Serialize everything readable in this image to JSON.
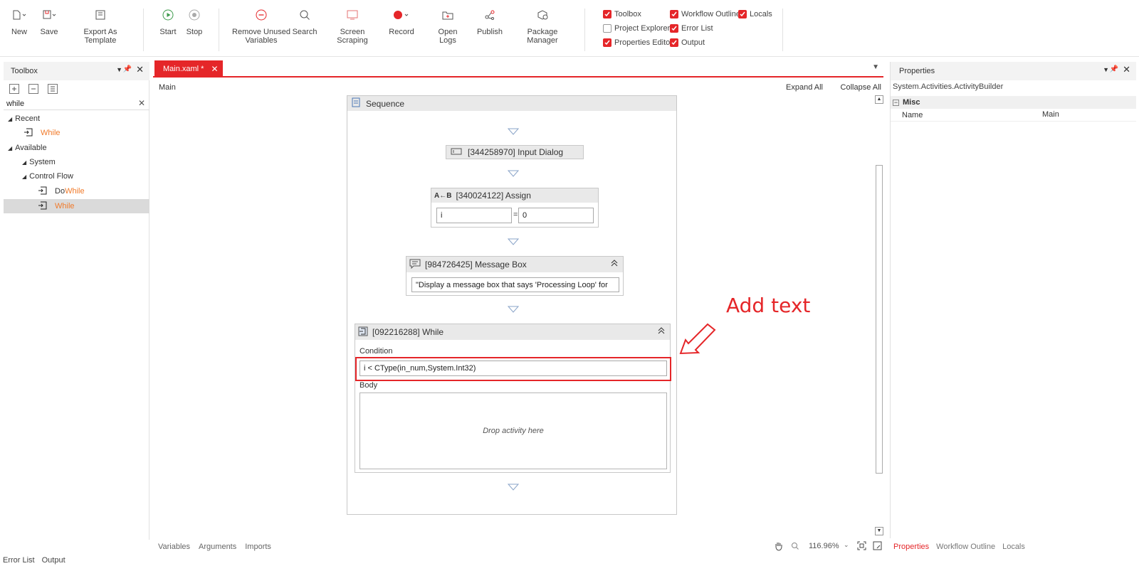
{
  "ribbon": {
    "new": "New",
    "save": "Save",
    "export_template": "Export As Template",
    "start": "Start",
    "stop": "Stop",
    "remove_unused": "Remove Unused Variables",
    "search": "Search",
    "screen_scraping": "Screen Scraping",
    "record": "Record",
    "open_logs": "Open Logs",
    "publish": "Publish",
    "package_manager": "Package Manager",
    "panes": {
      "toolbox": "Toolbox",
      "workflow_outline": "Workflow Outline",
      "locals": "Locals",
      "project_explorer": "Project Explorer",
      "error_list": "Error List",
      "properties_editor": "Properties Editor",
      "output": "Output"
    },
    "checked": {
      "toolbox": true,
      "workflow_outline": true,
      "locals": true,
      "project_explorer": false,
      "error_list": true,
      "properties_editor": true,
      "output": true
    }
  },
  "toolbox": {
    "title": "Toolbox",
    "search_value": "while",
    "tree": {
      "recent": "Recent",
      "recent_item": "While",
      "available": "Available",
      "system": "System",
      "control_flow": "Control Flow",
      "do": "Do ",
      "do_while": "While",
      "while": "While"
    }
  },
  "editor": {
    "tab": "Main.xaml *",
    "breadcrumb": "Main",
    "expand_all": "Expand All",
    "collapse_all": "Collapse All",
    "sequence": "Sequence",
    "input_dialog": "[344258970] Input Dialog",
    "assign": {
      "title": "[340024122] Assign",
      "left": "i",
      "eq": "=",
      "right": "0"
    },
    "message_box": {
      "title": "[984726425] Message Box",
      "text": "\"Display a message box that says 'Processing Loop' for"
    },
    "while": {
      "title": "[092216288] While",
      "condition_label": "Condition",
      "condition": "i < CType(in_num,System.Int32)",
      "body_label": "Body",
      "drop": "Drop activity here"
    },
    "annotation": "Add text",
    "bottom_tabs": [
      "Variables",
      "Arguments",
      "Imports"
    ],
    "zoom": "116.96%"
  },
  "properties": {
    "title": "Properties",
    "type": "System.Activities.ActivityBuilder",
    "category": "Misc",
    "name_label": "Name",
    "name_value": "Main",
    "tabs": [
      "Properties",
      "Workflow Outline",
      "Locals"
    ]
  },
  "status": {
    "error_list": "Error List",
    "output": "Output"
  },
  "colors": {
    "accent": "#e52629",
    "orange": "#f07a2a"
  }
}
